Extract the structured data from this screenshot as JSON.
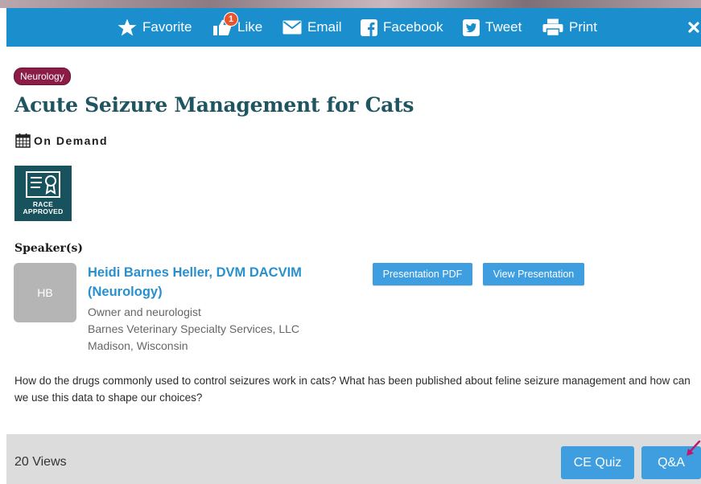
{
  "toolbar": {
    "favorite_label": "Favorite",
    "like_label": "Like",
    "like_count": "1",
    "email_label": "Email",
    "facebook_label": "Facebook",
    "tweet_label": "Tweet",
    "print_label": "Print"
  },
  "course": {
    "category": "Neurology",
    "title": "Acute Seizure Management for Cats",
    "availability": "On Demand",
    "badge_line1": "RACE",
    "badge_line2": "APPROVED"
  },
  "speakers": {
    "label": "Speaker(s)",
    "items": [
      {
        "initials": "HB",
        "name": "Heidi Barnes Heller, DVM DACVIM (Neurology)",
        "role": "Owner and neurologist",
        "organization": "Barnes Veterinary Specialty Services, LLC",
        "location": "Madison, Wisconsin",
        "pdf_button": "Presentation PDF",
        "view_button": "View Presentation"
      }
    ]
  },
  "description": "How do the drugs commonly used to control seizures work in cats? What has been published about feline seizure management and how can we use this data to shape our choices?",
  "footer": {
    "views": "20 Views",
    "quiz_button": "CE Quiz",
    "qa_button": "Q&A"
  },
  "colors": {
    "toolbar": "#1b8fce",
    "title": "#1f5561",
    "tag": "#8b1c46",
    "button": "#3e9ee0",
    "link": "#2990cf",
    "badge_bg": "#17525d"
  },
  "icons": [
    "star-icon",
    "thumbs-up-icon",
    "envelope-icon",
    "facebook-icon",
    "twitter-icon",
    "printer-icon",
    "close-icon",
    "calendar-icon",
    "certificate-icon"
  ]
}
